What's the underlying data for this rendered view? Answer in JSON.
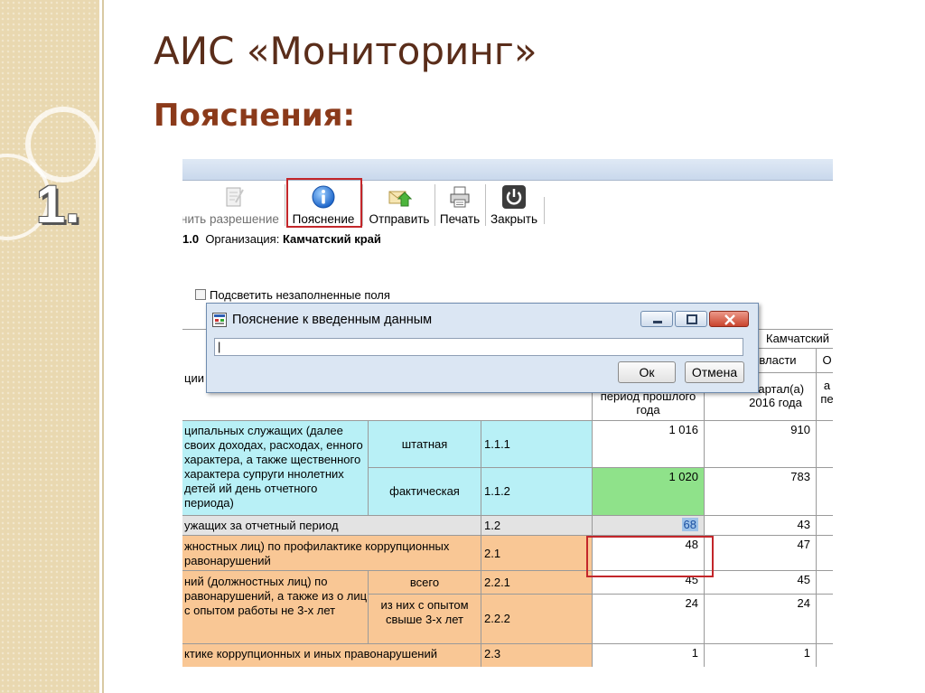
{
  "slide": {
    "title": "АИС «Мониторинг»",
    "subtitle": "Пояснения:",
    "number": "1."
  },
  "toolbar": {
    "buttons": [
      {
        "label": "нить разрешение",
        "icon": "permission-icon"
      },
      {
        "label": "Пояснение",
        "icon": "info-icon"
      },
      {
        "label": "Отправить",
        "icon": "send-mail-icon"
      },
      {
        "label": "Печать",
        "icon": "printer-icon"
      },
      {
        "label": "Закрыть",
        "icon": "power-icon"
      }
    ]
  },
  "org": {
    "prefix": "1.0",
    "label": "Организация:",
    "value": "Камчатский край"
  },
  "highlight_empty_label": "Подсветить незаполненные поля",
  "table": {
    "header": {
      "region": "Камчатский",
      "authority": "власти",
      "col_o": "О",
      "period_prev": "период прошлого года",
      "quarter": "квартал(а) 2016 года",
      "col_a": "а",
      "col_ne": "пе",
      "label_col": "ции"
    },
    "rows": [
      {
        "desc": "ципальных служащих (далее своих доходах, расходах, енного характера, а также щественного характера супруги ннолетних детей ий день отчетного периода)",
        "sub": "штатная",
        "code": "1.1.1",
        "prev": "1 016",
        "cur": "910"
      },
      {
        "sub": "фактическая",
        "code": "1.1.2",
        "prev": "1 020",
        "cur": "783"
      },
      {
        "desc": "ужащих за отчетный период",
        "code": "1.2",
        "prev": "68",
        "cur": "43"
      },
      {
        "desc": "жностных лиц) по профилактике коррупционных равонарушений",
        "code": "2.1",
        "prev": "48",
        "cur": "47"
      },
      {
        "desc": "ний (должностных лиц) по равонарушений, а также из о лиц с опытом работы не 3-х лет",
        "sub": "всего",
        "code": "2.2.1",
        "prev": "45",
        "cur": "45"
      },
      {
        "sub": "из них с опытом свыше 3-х лет",
        "code": "2.2.2",
        "prev": "24",
        "cur": "24"
      },
      {
        "desc": "ктике коррупционных и иных правонарушений",
        "code": "2.3",
        "prev": "1",
        "cur": "1"
      }
    ]
  },
  "dialog": {
    "title": "Пояснение к введенным данным",
    "input_value": "|",
    "ok_label": "Ок",
    "cancel_label": "Отмена"
  },
  "colors": {
    "highlight": "#c3262a",
    "title": "#5a2d1a",
    "subtitle": "#8b3a1a"
  }
}
